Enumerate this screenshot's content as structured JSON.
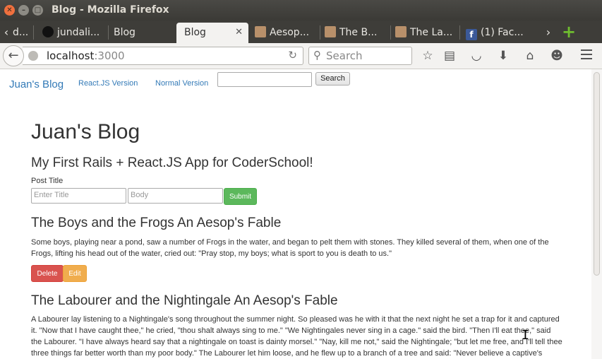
{
  "window": {
    "title": "Blog - Mozilla Firefox"
  },
  "tabs": [
    {
      "label": "d..."
    },
    {
      "label": "jundali..."
    },
    {
      "label": "Blog"
    },
    {
      "label": "Blog"
    },
    {
      "label": "Aesop..."
    },
    {
      "label": "The B..."
    },
    {
      "label": "The La..."
    },
    {
      "label": "(1) Fac..."
    }
  ],
  "nav": {
    "url_host": "localhost",
    "url_port": ":3000",
    "search_placeholder": "Search"
  },
  "site": {
    "brand": "Juan's Blog",
    "links": [
      "React.JS Version",
      "Normal Version"
    ],
    "search_button": "Search"
  },
  "main": {
    "heading": "Juan's Blog",
    "subheading": "My First Rails + React.JS App for CoderSchool!",
    "form": {
      "label": "Post Title",
      "title_placeholder": "Enter Title",
      "body_placeholder": "Body",
      "submit_label": "Submit"
    },
    "posts": [
      {
        "title": "The Boys and the Frogs An Aesop's Fable",
        "body": "Some boys, playing near a pond, saw a number of Frogs in the water, and began to pelt them with stones. They killed several of them, when one of the Frogs, lifting his head out of the water, cried out: \"Pray stop, my boys; what is sport to you is death to us.\"",
        "delete_label": "Delete",
        "edit_label": "Edit"
      },
      {
        "title": "The Labourer and the Nightingale An Aesop's Fable",
        "body": "A Labourer lay listening to a Nightingale's song throughout the summer night. So pleased was he with it that the next night he set a trap for it and captured it. \"Now that I have caught thee,\" he cried, \"thou shalt always sing to me.\" \"We Nightingales never sing in a cage.\" said the bird. \"Then I'll eat thee,\" said the Labourer. \"I have always heard say that a nightingale on toast is dainty morsel.\" \"Nay, kill me not,\" said the Nightingale; \"but let me free, and I'll tell thee three things far better worth than my poor body.\" The Labourer let him loose, and he flew up to a branch of a tree and said: \"Never believe a captive's"
      }
    ]
  }
}
